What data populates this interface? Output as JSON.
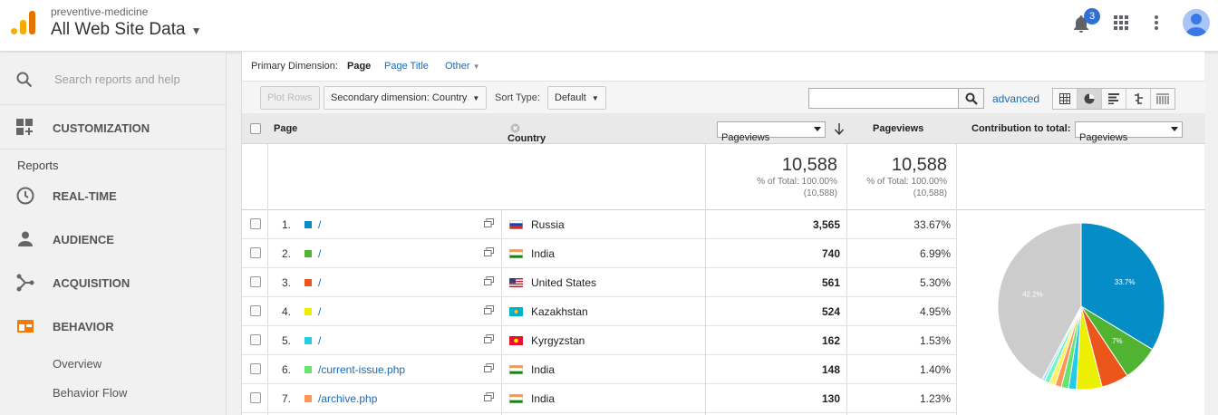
{
  "header": {
    "account": "preventive-medicine",
    "property": "All Web Site Data",
    "notifications_count": "3"
  },
  "sidebar": {
    "search_placeholder": "Search reports and help",
    "customization": "CUSTOMIZATION",
    "reports_heading": "Reports",
    "items": [
      {
        "label": "REAL-TIME",
        "icon": "clock-icon"
      },
      {
        "label": "AUDIENCE",
        "icon": "person-icon"
      },
      {
        "label": "ACQUISITION",
        "icon": "acquisition-icon"
      },
      {
        "label": "BEHAVIOR",
        "icon": "behavior-icon"
      }
    ],
    "subitems": [
      "Overview",
      "Behavior Flow"
    ],
    "accent_color": "#f57c00"
  },
  "dimension_bar": {
    "label": "Primary Dimension:",
    "active": "Page",
    "links": [
      "Page Title",
      "Other"
    ]
  },
  "toolbar": {
    "plot_rows": "Plot Rows",
    "secondary_dimension": "Secondary dimension: Country",
    "sort_type_label": "Sort Type:",
    "sort_type_value": "Default",
    "search_value": "",
    "advanced": "advanced"
  },
  "table": {
    "col_page": "Page",
    "col_country": "Country",
    "metric_select": "Pageviews",
    "col_pageviews": "Pageviews",
    "contribution_label": "Contribution to total:",
    "contribution_select": "Pageviews",
    "totals": {
      "value": "10,588",
      "pct": "% of Total: 100.00%",
      "abs": "(10,588)"
    },
    "rows": [
      {
        "num": "1.",
        "page": "/",
        "country": "Russia",
        "pageviews": "3,565",
        "pct": "33.67%",
        "color": "#058dc7"
      },
      {
        "num": "2.",
        "page": "/",
        "country": "India",
        "pageviews": "740",
        "pct": "6.99%",
        "color": "#50b432"
      },
      {
        "num": "3.",
        "page": "/",
        "country": "United States",
        "pageviews": "561",
        "pct": "5.30%",
        "color": "#ed561b"
      },
      {
        "num": "4.",
        "page": "/",
        "country": "Kazakhstan",
        "pageviews": "524",
        "pct": "4.95%",
        "color": "#edef00"
      },
      {
        "num": "5.",
        "page": "/",
        "country": "Kyrgyzstan",
        "pageviews": "162",
        "pct": "1.53%",
        "color": "#24cbe5"
      },
      {
        "num": "6.",
        "page": "/current-issue.php",
        "country": "India",
        "pageviews": "148",
        "pct": "1.40%",
        "color": "#64e572"
      },
      {
        "num": "7.",
        "page": "/archive.php",
        "country": "India",
        "pageviews": "130",
        "pct": "1.23%",
        "color": "#ff9655"
      }
    ]
  },
  "chart_data": {
    "type": "pie",
    "slices": [
      {
        "value": 33.67,
        "color": "#058dc7",
        "label": "33.7%"
      },
      {
        "value": 6.99,
        "color": "#50b432",
        "label": "7%"
      },
      {
        "value": 5.3,
        "color": "#ed561b",
        "label": ""
      },
      {
        "value": 4.95,
        "color": "#edef00",
        "label": ""
      },
      {
        "value": 1.53,
        "color": "#24cbe5",
        "label": ""
      },
      {
        "value": 1.4,
        "color": "#64e572",
        "label": ""
      },
      {
        "value": 1.23,
        "color": "#ff9655",
        "label": ""
      },
      {
        "value": 1.2,
        "color": "#fff263",
        "label": ""
      },
      {
        "value": 0.95,
        "color": "#6af9c4",
        "label": ""
      },
      {
        "value": 0.58,
        "color": "#b2deff",
        "label": ""
      },
      {
        "value": 42.2,
        "color": "#cccccc",
        "label": "42.2%"
      }
    ]
  }
}
